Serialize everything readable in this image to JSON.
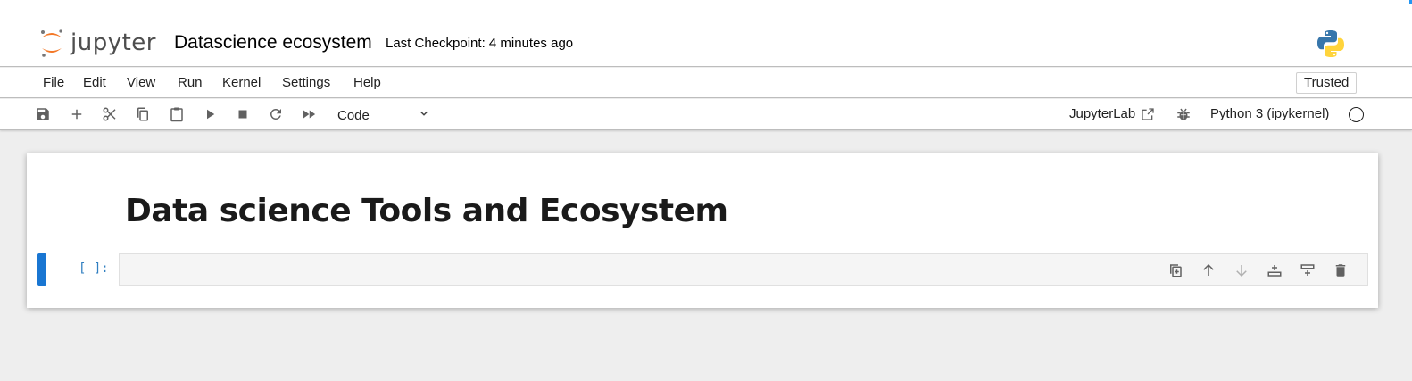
{
  "header": {
    "logo_text": "jupyter",
    "notebook_title": "Datascience ecosystem",
    "checkpoint": "Last Checkpoint: 4 minutes ago"
  },
  "menubar": {
    "items": [
      "File",
      "Edit",
      "View",
      "Run",
      "Kernel",
      "Settings",
      "Help"
    ],
    "trusted_label": "Trusted"
  },
  "toolbar": {
    "buttons": [
      "save-icon",
      "add-cell-icon",
      "cut-icon",
      "copy-icon",
      "paste-icon",
      "run-icon",
      "stop-icon",
      "restart-icon",
      "fast-forward-icon"
    ],
    "cell_type": "Code",
    "jupyterlab_label": "JupyterLab",
    "kernel_label": "Python 3 (ipykernel)"
  },
  "notebook": {
    "markdown_heading": "Data science Tools and Ecosystem",
    "code_cell": {
      "prompt": "[ ]:",
      "content": "",
      "tools": [
        "duplicate-cell-icon",
        "move-up-icon",
        "move-down-icon",
        "insert-above-icon",
        "insert-below-icon",
        "delete-cell-icon"
      ]
    }
  },
  "colors": {
    "accent": "#1976d2",
    "prompt": "#307fc1",
    "background": "#eeeeee",
    "jupyter_orange": "#f37726"
  }
}
